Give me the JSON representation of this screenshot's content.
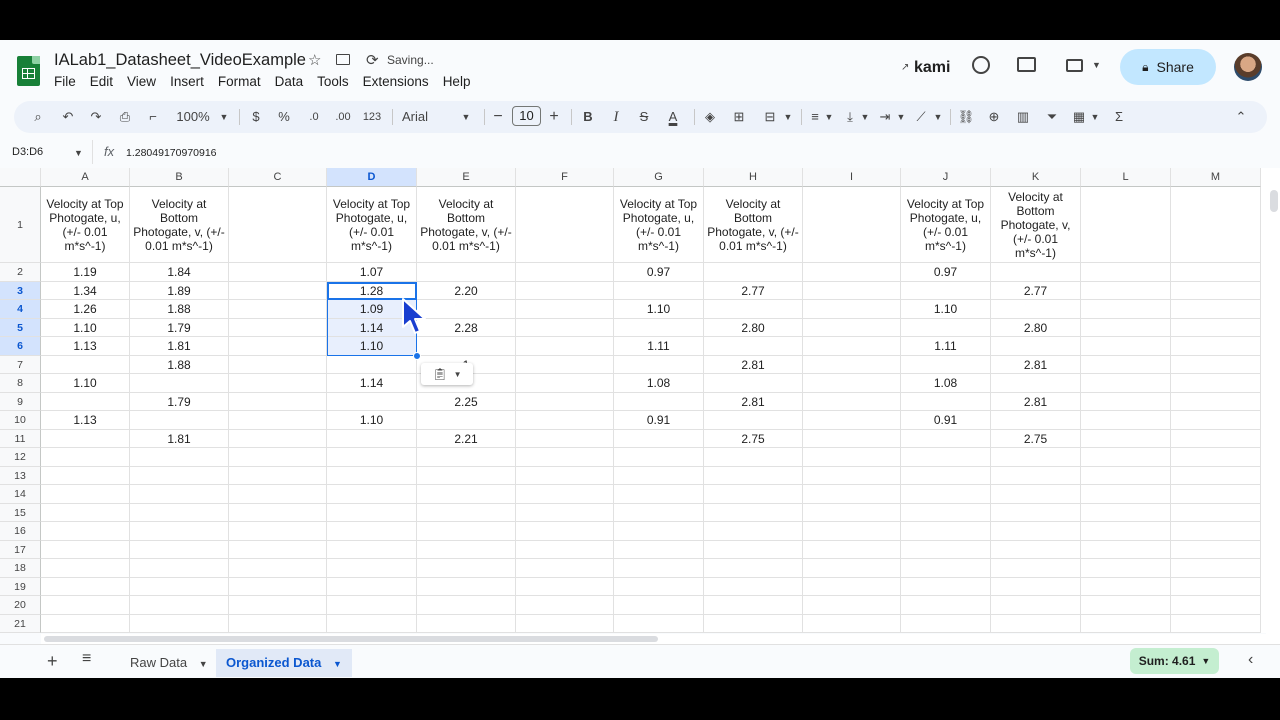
{
  "header": {
    "title": "IALab1_Datasheet_VideoExample",
    "status": "Saving...",
    "menu": [
      "File",
      "Edit",
      "View",
      "Insert",
      "Format",
      "Data",
      "Tools",
      "Extensions",
      "Help"
    ],
    "kami_label": "kami",
    "share_label": "Share"
  },
  "toolbar": {
    "zoom": "100%",
    "currency": "$",
    "percent": "%",
    "dec_decrease": ".0",
    "dec_increase": ".00",
    "number_format": "123",
    "font": "Arial",
    "font_size": "10",
    "minus": "−",
    "plus": "+",
    "bold": "B",
    "italic": "I",
    "strike": "S",
    "text_color": "A",
    "sum_icon": "Σ"
  },
  "formula_bar": {
    "name_box": "D3:D6",
    "fx": "fx",
    "value": "1.28049170970916"
  },
  "grid": {
    "columns": [
      "A",
      "B",
      "C",
      "D",
      "E",
      "F",
      "G",
      "H",
      "I",
      "J",
      "K",
      "L",
      "M"
    ],
    "rows": [
      "1",
      "2",
      "3",
      "4",
      "5",
      "6",
      "7",
      "8",
      "9",
      "10",
      "11",
      "12",
      "13",
      "14",
      "15",
      "16",
      "17",
      "18",
      "19",
      "20",
      "21"
    ],
    "headers": {
      "A": "Velocity at Top Photogate, u, (+/- 0.01 m*s^-1)",
      "B": "Velocity at Bottom Photogate, v, (+/- 0.01 m*s^-1)",
      "D": "Velocity at Top Photogate, u, (+/- 0.01 m*s^-1)",
      "E": "Velocity at Bottom Photogate, v, (+/- 0.01 m*s^-1)",
      "G": "Velocity at Top Photogate, u, (+/- 0.01 m*s^-1)",
      "H": "Velocity at Bottom Photogate, v, (+/- 0.01 m*s^-1)",
      "J": "Velocity at Top Photogate, u, (+/- 0.01 m*s^-1)",
      "K": "Velocity at Bottom Photogate, v, (+/- 0.01 m*s^-1)"
    },
    "values": {
      "A": [
        "1.19",
        "1.34",
        "1.26",
        "1.10",
        "1.13",
        "",
        "1.10",
        "",
        "1.13",
        ""
      ],
      "B": [
        "1.84",
        "1.89",
        "1.88",
        "1.79",
        "1.81",
        "1.88",
        "",
        "1.79",
        "",
        "1.81"
      ],
      "D": [
        "1.07",
        "1.28",
        "1.09",
        "1.14",
        "1.10",
        "",
        "1.14",
        "",
        "1.10",
        ""
      ],
      "E": [
        "",
        "2.20",
        "",
        "2.28",
        "",
        "1",
        "",
        "2.25",
        "",
        "2.21"
      ],
      "G": [
        "0.97",
        "",
        "1.10",
        "",
        "1.11",
        "",
        "1.08",
        "",
        "0.91",
        ""
      ],
      "H": [
        "",
        "2.77",
        "",
        "2.80",
        "",
        "2.81",
        "",
        "2.81",
        "",
        "2.75"
      ],
      "J": [
        "0.97",
        "",
        "1.10",
        "",
        "1.11",
        "",
        "1.08",
        "",
        "0.91",
        ""
      ],
      "K": [
        "",
        "2.77",
        "",
        "2.80",
        "",
        "2.81",
        "",
        "2.81",
        "",
        "2.75"
      ]
    }
  },
  "sheets": {
    "tabs": [
      "Raw Data",
      "Organized Data"
    ],
    "active": "Organized Data",
    "sum": "Sum: 4.61"
  }
}
